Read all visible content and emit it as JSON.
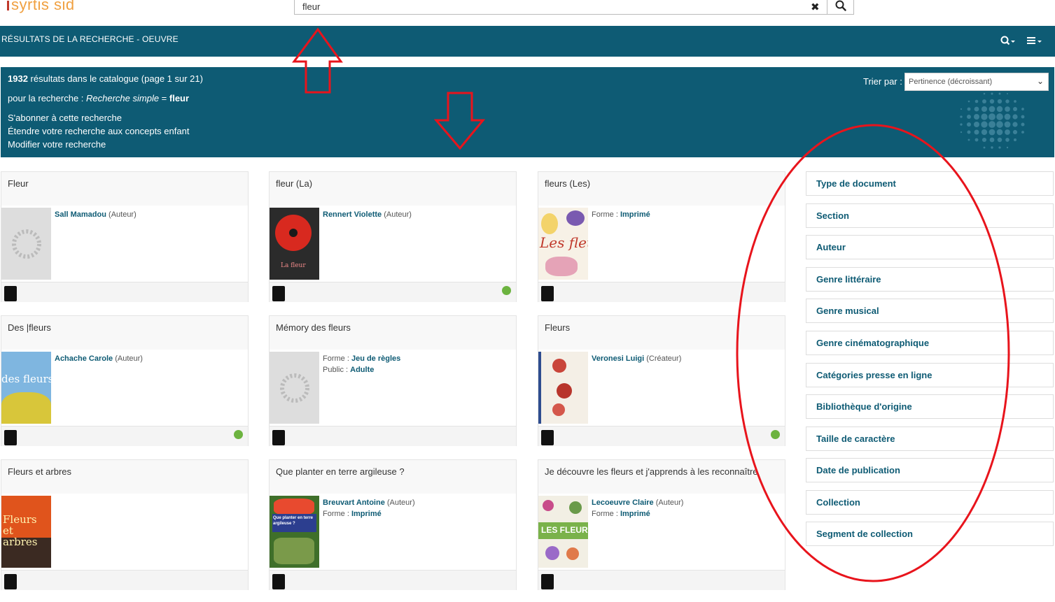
{
  "header": {
    "logo": "syrtis sid",
    "search": {
      "value": "fleur"
    }
  },
  "bar": {
    "title": "RÉSULTATS DE LA RECHERCHE - OEUVRE",
    "search_tool_icon": "search-dropdown-icon",
    "menu_tool_icon": "menu-dropdown-icon"
  },
  "info": {
    "count": "1932",
    "count_rest": " résultats dans le catalogue (page 1 sur 21)",
    "query_prefix": "pour la recherche : ",
    "query_type": "Recherche simple",
    "query_eq": " = ",
    "query_term": "fleur",
    "subscribe": "S'abonner à cette recherche",
    "extend": "Étendre votre recherche aux concepts enfant",
    "modify": "Modifier votre recherche",
    "sort_label": "Trier par :",
    "sort_value": "Pertinence (décroissant)"
  },
  "results": [
    {
      "title": "Fleur",
      "line1_name": "Sall Mamadou",
      "line1_rest": " (Auteur)",
      "line2_label": "",
      "line2_value": "",
      "available": false
    },
    {
      "title": "fleur (La)",
      "line1_name": "Rennert Violette",
      "line1_rest": " (Auteur)",
      "line2_label": "",
      "line2_value": "",
      "available": true
    },
    {
      "title": "fleurs (Les)",
      "line1_label": "Forme : ",
      "line1_value": "Imprimé",
      "available": false
    },
    {
      "title": "Des |fleurs",
      "line1_name": "Achache Carole",
      "line1_rest": " (Auteur)",
      "available": true
    },
    {
      "title": "Mémory des fleurs",
      "line1_label": "Forme : ",
      "line1_value": "Jeu de règles",
      "line2_label": "Public : ",
      "line2_value": "Adulte",
      "available": false
    },
    {
      "title": "Fleurs",
      "line1_name": "Veronesi Luigi",
      "line1_rest": " (Créateur)",
      "available": true
    },
    {
      "title": "Fleurs et arbres",
      "available": false
    },
    {
      "title": "Que planter en terre argileuse ?",
      "line1_name": "Breuvart Antoine",
      "line1_rest": " (Auteur)",
      "line2_label": "Forme : ",
      "line2_value": "Imprimé",
      "available": false
    },
    {
      "title": "Je découvre les fleurs et j'apprends à les reconnaître",
      "line1_name": "Lecoeuvre Claire",
      "line1_rest": " (Auteur)",
      "line2_label": "Forme : ",
      "line2_value": "Imprimé",
      "available": false
    }
  ],
  "facets": [
    "Type de document",
    "Section",
    "Auteur",
    "Genre littéraire",
    "Genre musical",
    "Genre cinématographique",
    "Catégories presse en ligne",
    "Bibliothèque d'origine",
    "Taille de caractère",
    "Date de publication",
    "Collection",
    "Segment de collection"
  ],
  "colors": {
    "brand": "#0e5b74",
    "available": "#6cb33f",
    "annotation": "#e8141c"
  },
  "thumbnail_texts": {
    "r1": "La fleur",
    "r2": "Les fleurs",
    "r3": "des fleurs",
    "r6": "Fleurs et arbres",
    "r7": "Que planter en terre argileuse ?",
    "r8": "LES FLEURS"
  }
}
